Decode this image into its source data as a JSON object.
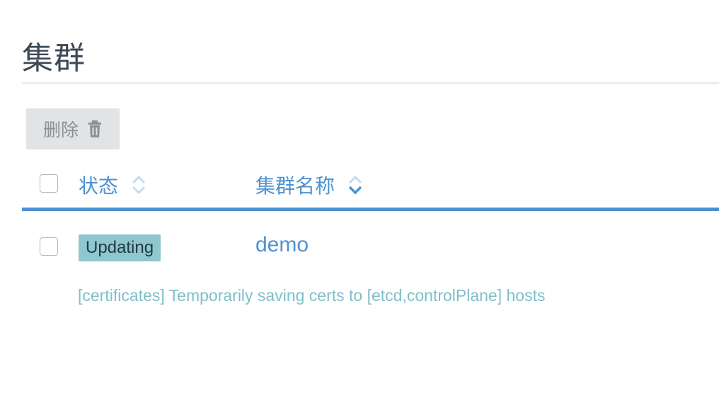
{
  "page": {
    "title": "集群"
  },
  "toolbar": {
    "delete_label": "删除",
    "delete_icon": "trash-icon"
  },
  "table": {
    "columns": [
      {
        "label": "状态",
        "sort_icon": "sort-icon"
      },
      {
        "label": "集群名称",
        "sort_icon": "sort-desc-icon"
      }
    ],
    "rows": [
      {
        "state": "Updating",
        "name": "demo",
        "message": "[certificates] Temporarily saving certs to [etcd,controlPlane] hosts",
        "checked": false
      }
    ]
  },
  "colors": {
    "accent": "#4e92d0",
    "badge_bg": "#8ec7cf",
    "message": "#7fbfc9",
    "button_bg": "#e1e3e5"
  }
}
